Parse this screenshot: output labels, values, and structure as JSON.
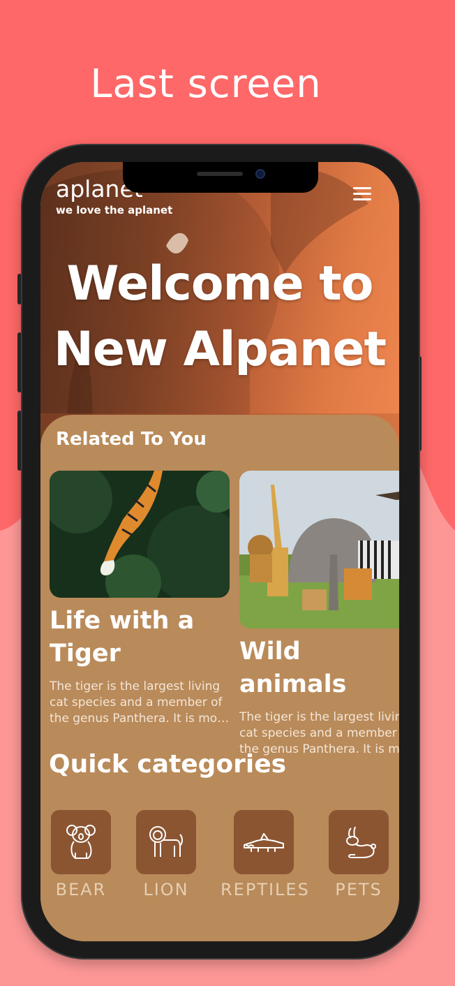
{
  "page": {
    "title": "Last screen"
  },
  "header": {
    "brand": "aplanet",
    "tagline": "we love the aplanet"
  },
  "hero": {
    "line1": "Welcome to",
    "line2": "New Alpanet"
  },
  "related": {
    "title": "Related To You",
    "cards": [
      {
        "title_line1": "Life with a",
        "title_line2": "Tiger",
        "description": "The tiger is the largest living cat species and a member of the genus Panthera. It is most recognisable for its dark vertical stripes."
      },
      {
        "title_line1": "Wild animals",
        "desc_line1": "The tiger is the largest living",
        "desc_line2": "cat species and a member of",
        "desc_line3": "the genus Panthera. It is mo"
      }
    ]
  },
  "quick": {
    "title": "Quick categories",
    "categories": [
      {
        "label": "BEAR",
        "icon": "koala-icon"
      },
      {
        "label": "LION",
        "icon": "lion-icon"
      },
      {
        "label": "REPTILES",
        "icon": "crocodile-icon"
      },
      {
        "label": "PETS",
        "icon": "rabbit-icon"
      }
    ]
  },
  "colors": {
    "background_top": "#fe6868",
    "background_bottom": "#fc9796",
    "sheet": "#b98a5a",
    "category_tile": "#8b5532"
  }
}
